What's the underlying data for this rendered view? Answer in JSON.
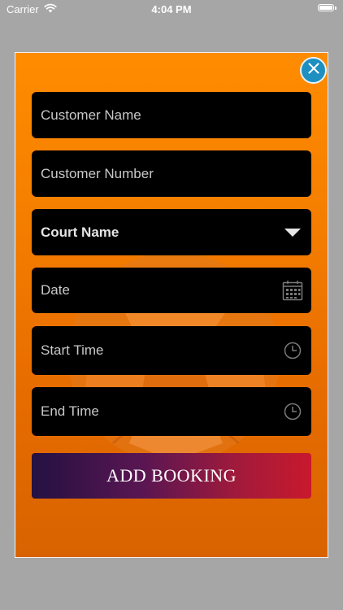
{
  "status_bar": {
    "carrier": "Carrier",
    "time": "4:04 PM",
    "battery_level": 1.0
  },
  "modal": {
    "close_icon": "close-icon",
    "fields": {
      "customer_name": {
        "placeholder": "Customer Name"
      },
      "customer_number": {
        "placeholder": "Customer Number"
      },
      "court_name": {
        "value": "Court Name",
        "icon": "dropdown-triangle-icon"
      },
      "date": {
        "placeholder": "Date",
        "icon": "calendar-icon"
      },
      "start_time": {
        "placeholder": "Start Time",
        "icon": "clock-icon"
      },
      "end_time": {
        "placeholder": "End Time",
        "icon": "clock-icon"
      }
    },
    "add_booking_label": "ADD BOOKING"
  },
  "colors": {
    "modal_orange": "#ff8c00",
    "field_bg": "#000000",
    "close_blue": "#1d8fc0",
    "button_gradient_start": "#241142",
    "button_gradient_end": "#c8192d"
  }
}
